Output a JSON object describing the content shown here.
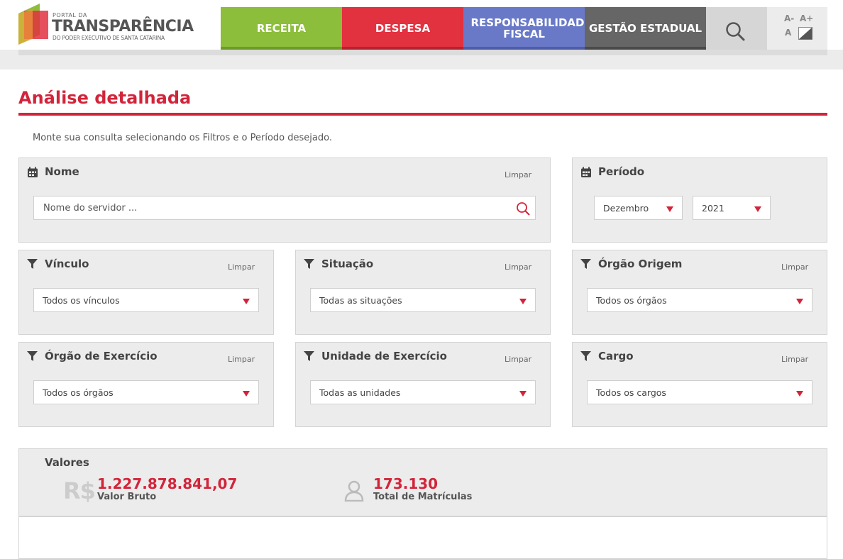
{
  "header": {
    "logo": {
      "small": "PORTAL DA",
      "big": "TRANSPARÊNCIA",
      "sub": "DO PODER EXECUTIVO DE SANTA CATARINA"
    },
    "nav": {
      "receita": "RECEITA",
      "despesa": "DESPESA",
      "responsabilidade": "RESPONSABILIDADE FISCAL",
      "gestao": "GESTÃO ESTADUAL"
    },
    "font_tools": {
      "decrease": "A-",
      "increase": "A+",
      "reset": "A"
    },
    "colors": {
      "receita": "#8cbe3b",
      "despesa": "#e2313f",
      "responsabilidade": "#6979c8",
      "gestao": "#666666",
      "accent": "#d2243a"
    }
  },
  "page": {
    "title": "Análise detalhada",
    "intro": "Monte sua consulta selecionando os Filtros e o Período desejado."
  },
  "filters": {
    "clear_label": "Limpar",
    "nome": {
      "title": "Nome",
      "placeholder": "Nome do servidor ..."
    },
    "periodo": {
      "title": "Período",
      "month": "Dezembro",
      "year": "2021"
    },
    "vinculo": {
      "title": "Vínculo",
      "value": "Todos os vínculos"
    },
    "situacao": {
      "title": "Situação",
      "value": "Todas as situações"
    },
    "orgao_origem": {
      "title": "Órgão Origem",
      "value": "Todos os órgãos"
    },
    "orgao_exercicio": {
      "title": "Órgão de Exercício",
      "value": "Todos os órgãos"
    },
    "unidade_exercicio": {
      "title": "Unidade de Exercício",
      "value": "Todas as unidades"
    },
    "cargo": {
      "title": "Cargo",
      "value": "Todos os cargos"
    }
  },
  "valores": {
    "title": "Valores",
    "currency_symbol": "R$",
    "valor_bruto": {
      "value": "1.227.878.841,07",
      "label": "Valor Bruto"
    },
    "matriculas": {
      "value": "173.130",
      "label": "Total de Matrículas"
    }
  }
}
